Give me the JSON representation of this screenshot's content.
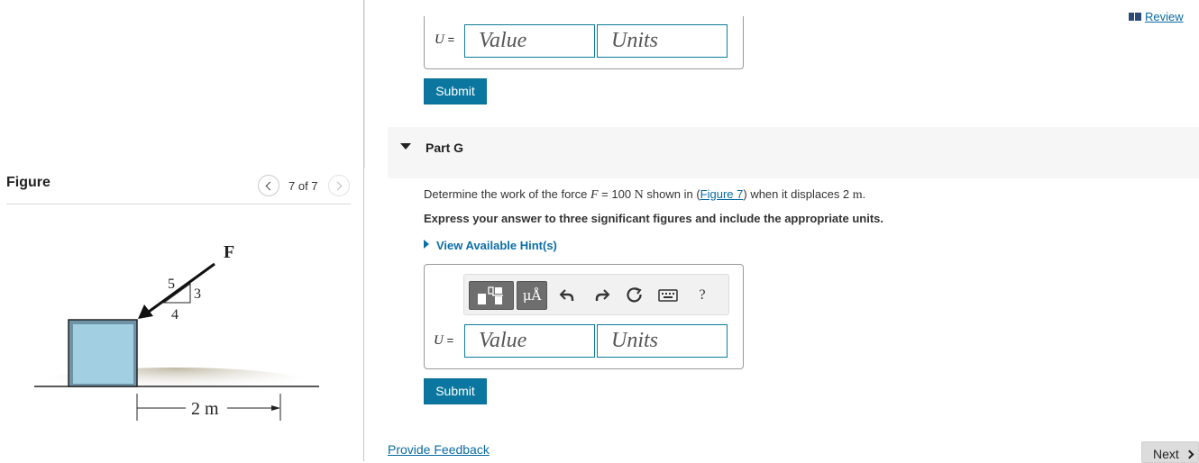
{
  "review": {
    "label": "Review",
    "icon": "book-icon"
  },
  "part_f": {
    "variable": "U",
    "equals": "=",
    "value_placeholder": "Value",
    "units_placeholder": "Units",
    "submit_label": "Submit"
  },
  "part_g": {
    "title": "Part G",
    "prompt": {
      "before": "Determine the work of the force ",
      "force_symbol": "F",
      "force_eq": " = 100 ",
      "force_unit": "N",
      "middle": " shown in (",
      "figure_link": "Figure 7",
      "after": ") when it displaces 2 ",
      "disp_unit": "m",
      "end": "."
    },
    "instruction": "Express your answer to three significant figures and include the appropriate units.",
    "hint_label": "View Available Hint(s)",
    "toolbar": {
      "templates_icon": "templates-icon",
      "units_button": "μÅ",
      "undo_icon": "undo-icon",
      "redo_icon": "redo-icon",
      "reset_icon": "reset-icon",
      "keyboard_icon": "keyboard-icon",
      "help": "?"
    },
    "variable": "U",
    "equals": "=",
    "value_placeholder": "Value",
    "units_placeholder": "Units",
    "submit_label": "Submit"
  },
  "figure": {
    "title": "Figure",
    "counter": "7 of 7",
    "force_label": "F",
    "slope_hyp": "5",
    "slope_rise": "3",
    "slope_run": "4",
    "distance_label": "2 m",
    "colors": {
      "block": "#a3cfe2",
      "arrow": "#111111"
    }
  },
  "footer": {
    "feedback": "Provide Feedback",
    "next": "Next"
  }
}
